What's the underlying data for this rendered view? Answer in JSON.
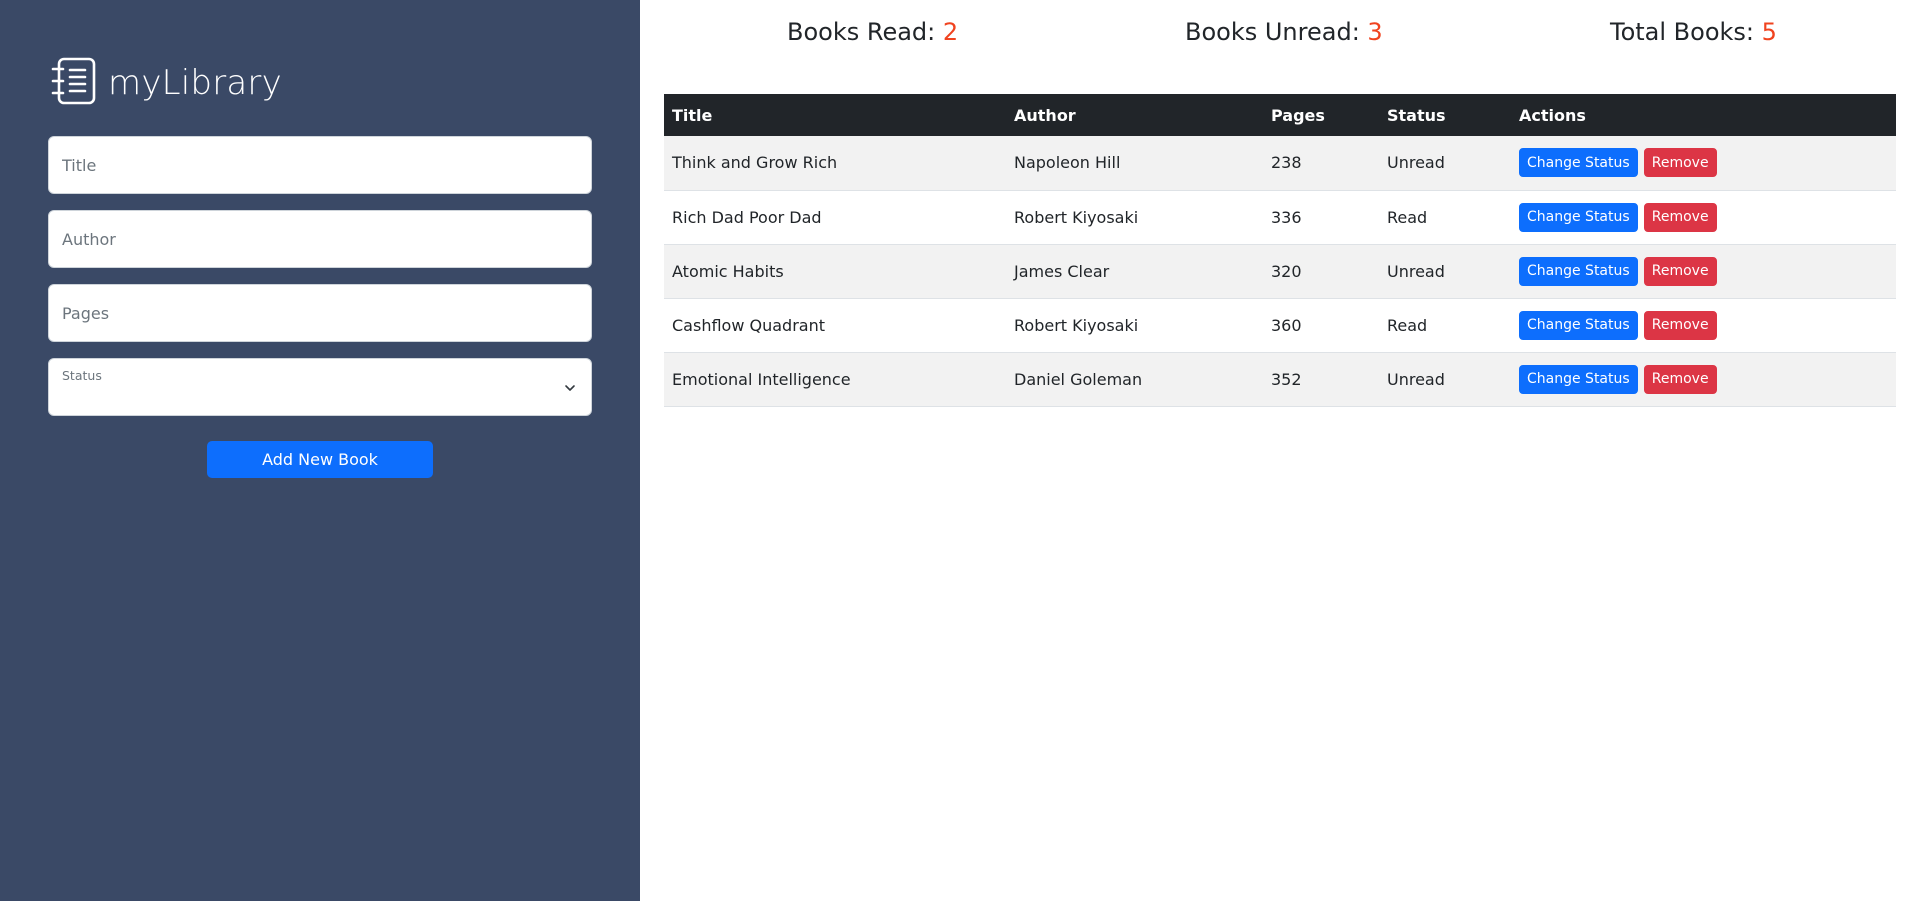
{
  "sidebar": {
    "brand": "myLibrary",
    "title_placeholder": "Title",
    "author_placeholder": "Author",
    "pages_placeholder": "Pages",
    "status_label": "Status",
    "status_value": "",
    "add_button": "Add New Book",
    "background": "#3a4966"
  },
  "stats": {
    "read_label": "Books Read:",
    "read_count": "2",
    "unread_label": "Books Unread:",
    "unread_count": "3",
    "total_label": "Total Books:",
    "total_count": "5",
    "count_color": "#f0431f"
  },
  "table": {
    "headers": [
      "Title",
      "Author",
      "Pages",
      "Status",
      "Actions"
    ],
    "change_label": "Change Status",
    "remove_label": "Remove",
    "rows": [
      {
        "title": "Think and Grow Rich",
        "author": "Napoleon Hill",
        "pages": "238",
        "status": "Unread"
      },
      {
        "title": "Rich Dad Poor Dad",
        "author": "Robert Kiyosaki",
        "pages": "336",
        "status": "Read"
      },
      {
        "title": "Atomic Habits",
        "author": "James Clear",
        "pages": "320",
        "status": "Unread"
      },
      {
        "title": "Cashflow Quadrant",
        "author": "Robert Kiyosaki",
        "pages": "360",
        "status": "Read"
      },
      {
        "title": "Emotional Intelligence",
        "author": "Daniel Goleman",
        "pages": "352",
        "status": "Unread"
      }
    ]
  },
  "icons": {
    "brand": "notebook-icon",
    "select": "chevron-down-icon"
  }
}
